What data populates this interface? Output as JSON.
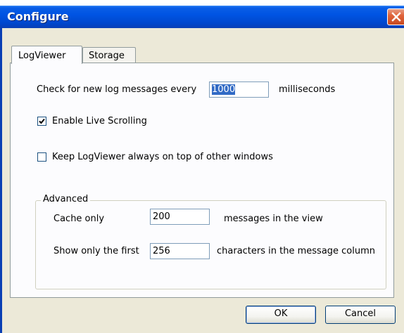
{
  "window": {
    "title": "Configure"
  },
  "tabs": [
    {
      "label": "LogViewer",
      "active": true
    },
    {
      "label": "Storage",
      "active": false
    }
  ],
  "logviewer": {
    "poll_prefix": "Check for new log messages every",
    "poll_value": "1000",
    "poll_suffix": "milliseconds",
    "live_scrolling_label": "Enable Live Scrolling",
    "live_scrolling_checked": true,
    "always_on_top_label": "Keep LogViewer always on top of other windows",
    "always_on_top_checked": false
  },
  "advanced": {
    "title": "Advanced",
    "cache_prefix": "Cache only",
    "cache_value": "200",
    "cache_suffix": "messages in the view",
    "chars_prefix": "Show only the first",
    "chars_value": "256",
    "chars_suffix": "characters in the message column"
  },
  "buttons": {
    "ok": "OK",
    "cancel": "Cancel"
  },
  "colors": {
    "titlebar": "#0054e3",
    "dialog_bg": "#ece9d8",
    "selection": "#316ac5",
    "close_button": "#e0643c"
  }
}
